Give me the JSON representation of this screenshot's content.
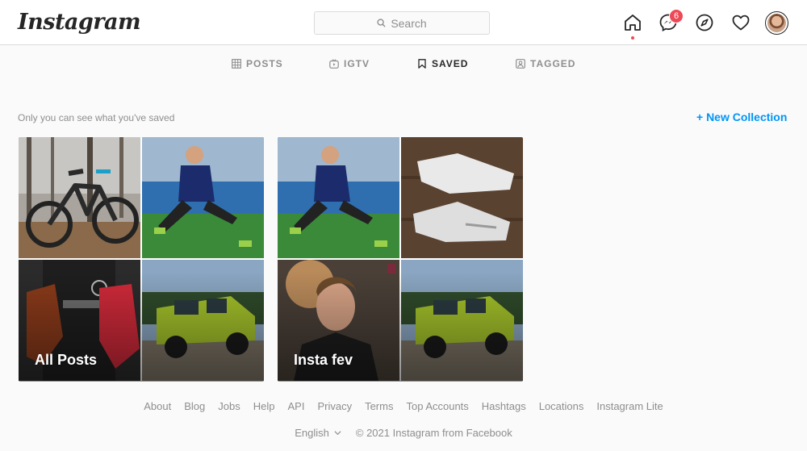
{
  "header": {
    "logo_text": "Instagram",
    "search_placeholder": "Search",
    "messenger_badge": "6"
  },
  "tabs": [
    {
      "label": "POSTS",
      "icon": "grid-icon",
      "active": false
    },
    {
      "label": "IGTV",
      "icon": "igtv-icon",
      "active": false
    },
    {
      "label": "SAVED",
      "icon": "bookmark-icon",
      "active": true
    },
    {
      "label": "TAGGED",
      "icon": "tagged-icon",
      "active": false
    }
  ],
  "saved": {
    "notice": "Only you can see what you've saved",
    "new_collection": "+ New Collection"
  },
  "collections": [
    {
      "name": "All Posts",
      "thumbs": [
        "bike-photo",
        "soccer-player-photo",
        "goalkeeper-gloves-photo",
        "green-suv-photo"
      ]
    },
    {
      "name": "Insta fev",
      "thumbs": [
        "soccer-player-photo",
        "white-boots-photo",
        "smiling-man-photo",
        "green-suv-photo"
      ]
    }
  ],
  "footer": {
    "links": [
      "About",
      "Blog",
      "Jobs",
      "Help",
      "API",
      "Privacy",
      "Terms",
      "Top Accounts",
      "Hashtags",
      "Locations",
      "Instagram Lite"
    ],
    "language": "English",
    "copyright": "© 2021 Instagram from Facebook"
  },
  "colors": {
    "accent": "#0095f6",
    "badge": "#ed4956",
    "border": "#dbdbdb",
    "muted": "#8e8e8e"
  }
}
